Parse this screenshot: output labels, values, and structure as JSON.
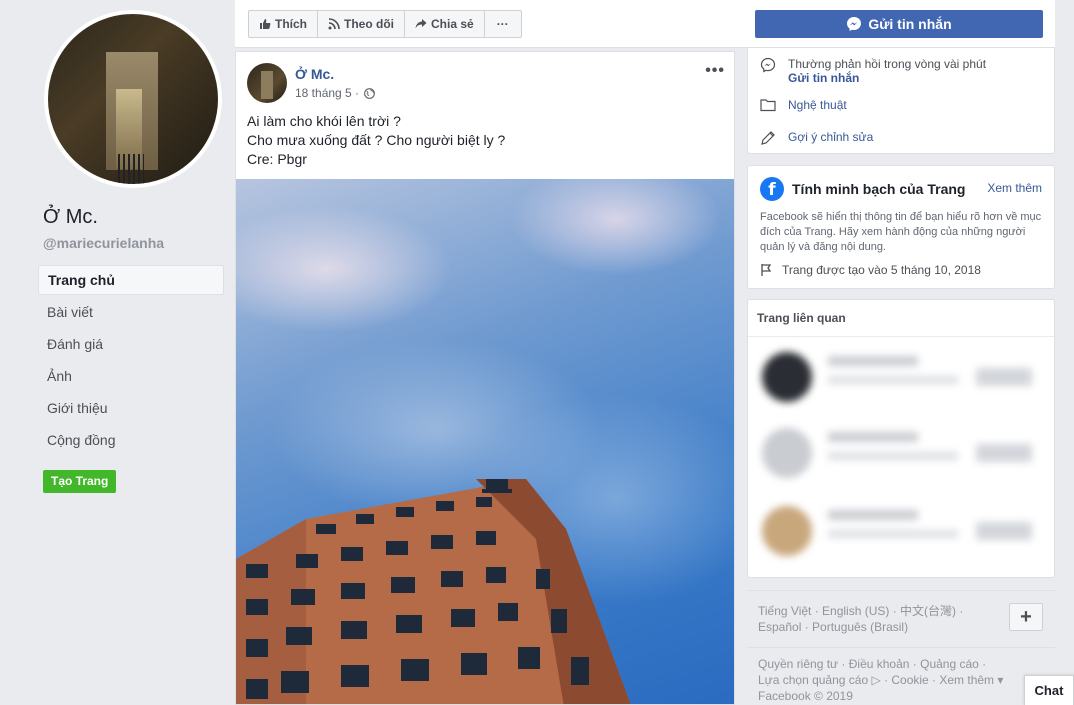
{
  "profile": {
    "name": "Ở Mc.",
    "handle": "@mariecurielanha"
  },
  "nav": {
    "items": [
      "Trang chủ",
      "Bài viết",
      "Đánh giá",
      "Ảnh",
      "Giới thiệu",
      "Cộng đồng"
    ],
    "active_index": 0
  },
  "create_page_label": "Tạo Trang",
  "actions": {
    "like": "Thích",
    "follow": "Theo dõi",
    "share": "Chia sẻ",
    "more": "···"
  },
  "send_message_label": "Gửi tin nhắn",
  "post": {
    "author": "Ở Mc.",
    "date": "18 tháng 5 ·",
    "more": "•••",
    "lines": [
      "Ai làm cho khói lên trời ?",
      "Cho mưa xuống đất ? Cho người biệt ly ?",
      "Cre: Pbgr"
    ]
  },
  "about": {
    "response_time": "Thường phản hồi trong vòng vài phút",
    "send_message_link": "Gửi tin nhắn",
    "category": "Nghệ thuật",
    "suggest_edit": "Gợi ý chỉnh sửa"
  },
  "transparency": {
    "title": "Tính minh bạch của Trang",
    "see_more": "Xem thêm",
    "description": "Facebook sẽ hiển thị thông tin để bạn hiểu rõ hơn về mục đích của Trang. Hãy xem hành động của những người quản lý và đăng nội dung.",
    "created": "Trang được tạo vào 5 tháng 10, 2018"
  },
  "related": {
    "title": "Trang liên quan"
  },
  "languages": {
    "text": "Tiếng Việt · English (US) · 中文(台灣) · Español · Português (Brasil)",
    "plus": "+"
  },
  "footer": {
    "line1": "Quyền riêng tư · Điều khoản · Quảng cáo ·",
    "line2": "Lựa chọn quảng cáo ▷ · Cookie · Xem thêm ▾",
    "line3": "Facebook © 2019"
  },
  "chat_label": "Chat",
  "colors": {
    "brand_blue": "#4267b2",
    "link": "#385898",
    "green": "#42b72a"
  }
}
